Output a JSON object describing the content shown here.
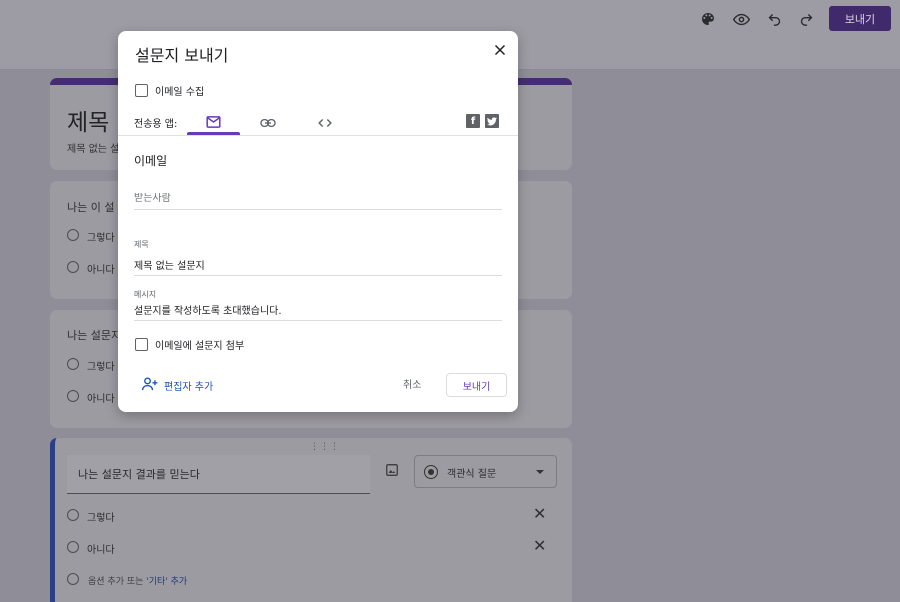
{
  "toolbar": {
    "send_label": "보내기",
    "icons": [
      "palette-icon",
      "eye-icon",
      "undo-icon",
      "redo-icon"
    ]
  },
  "form": {
    "title": "제목",
    "description": "제목 없는 설",
    "questions": [
      {
        "text": "나는 이 설",
        "options": [
          "그렇다",
          "아니다"
        ]
      },
      {
        "text": "나는 설문지",
        "options": [
          "그렇다",
          "아니다"
        ]
      }
    ],
    "active_question": {
      "text": "나는 설문지 결과를 믿는다",
      "type_label": "객관식 질문",
      "options": [
        "그렇다",
        "아니다"
      ],
      "add_option_text": "옵션 추가 또는",
      "add_other_link": "'기타' 추가"
    }
  },
  "modal": {
    "title": "설문지 보내기",
    "collect_email_label": "이메일 수집",
    "send_via_label": "전송용 앱:",
    "tabs": [
      "email-tab",
      "link-tab",
      "embed-tab"
    ],
    "section_title": "이메일",
    "to_placeholder": "받는사람",
    "subject_label": "제목",
    "subject_value": "제목 없는 설문지",
    "message_label": "메시지",
    "message_value": "설문지를 작성하도록 초대했습니다.",
    "include_form_label": "이메일에 설문지 첨부",
    "add_editors_label": "편집자 추가",
    "cancel_label": "취소",
    "send_label": "보내기"
  },
  "colors": {
    "accent": "#673ab7",
    "link": "#1a56b6"
  }
}
